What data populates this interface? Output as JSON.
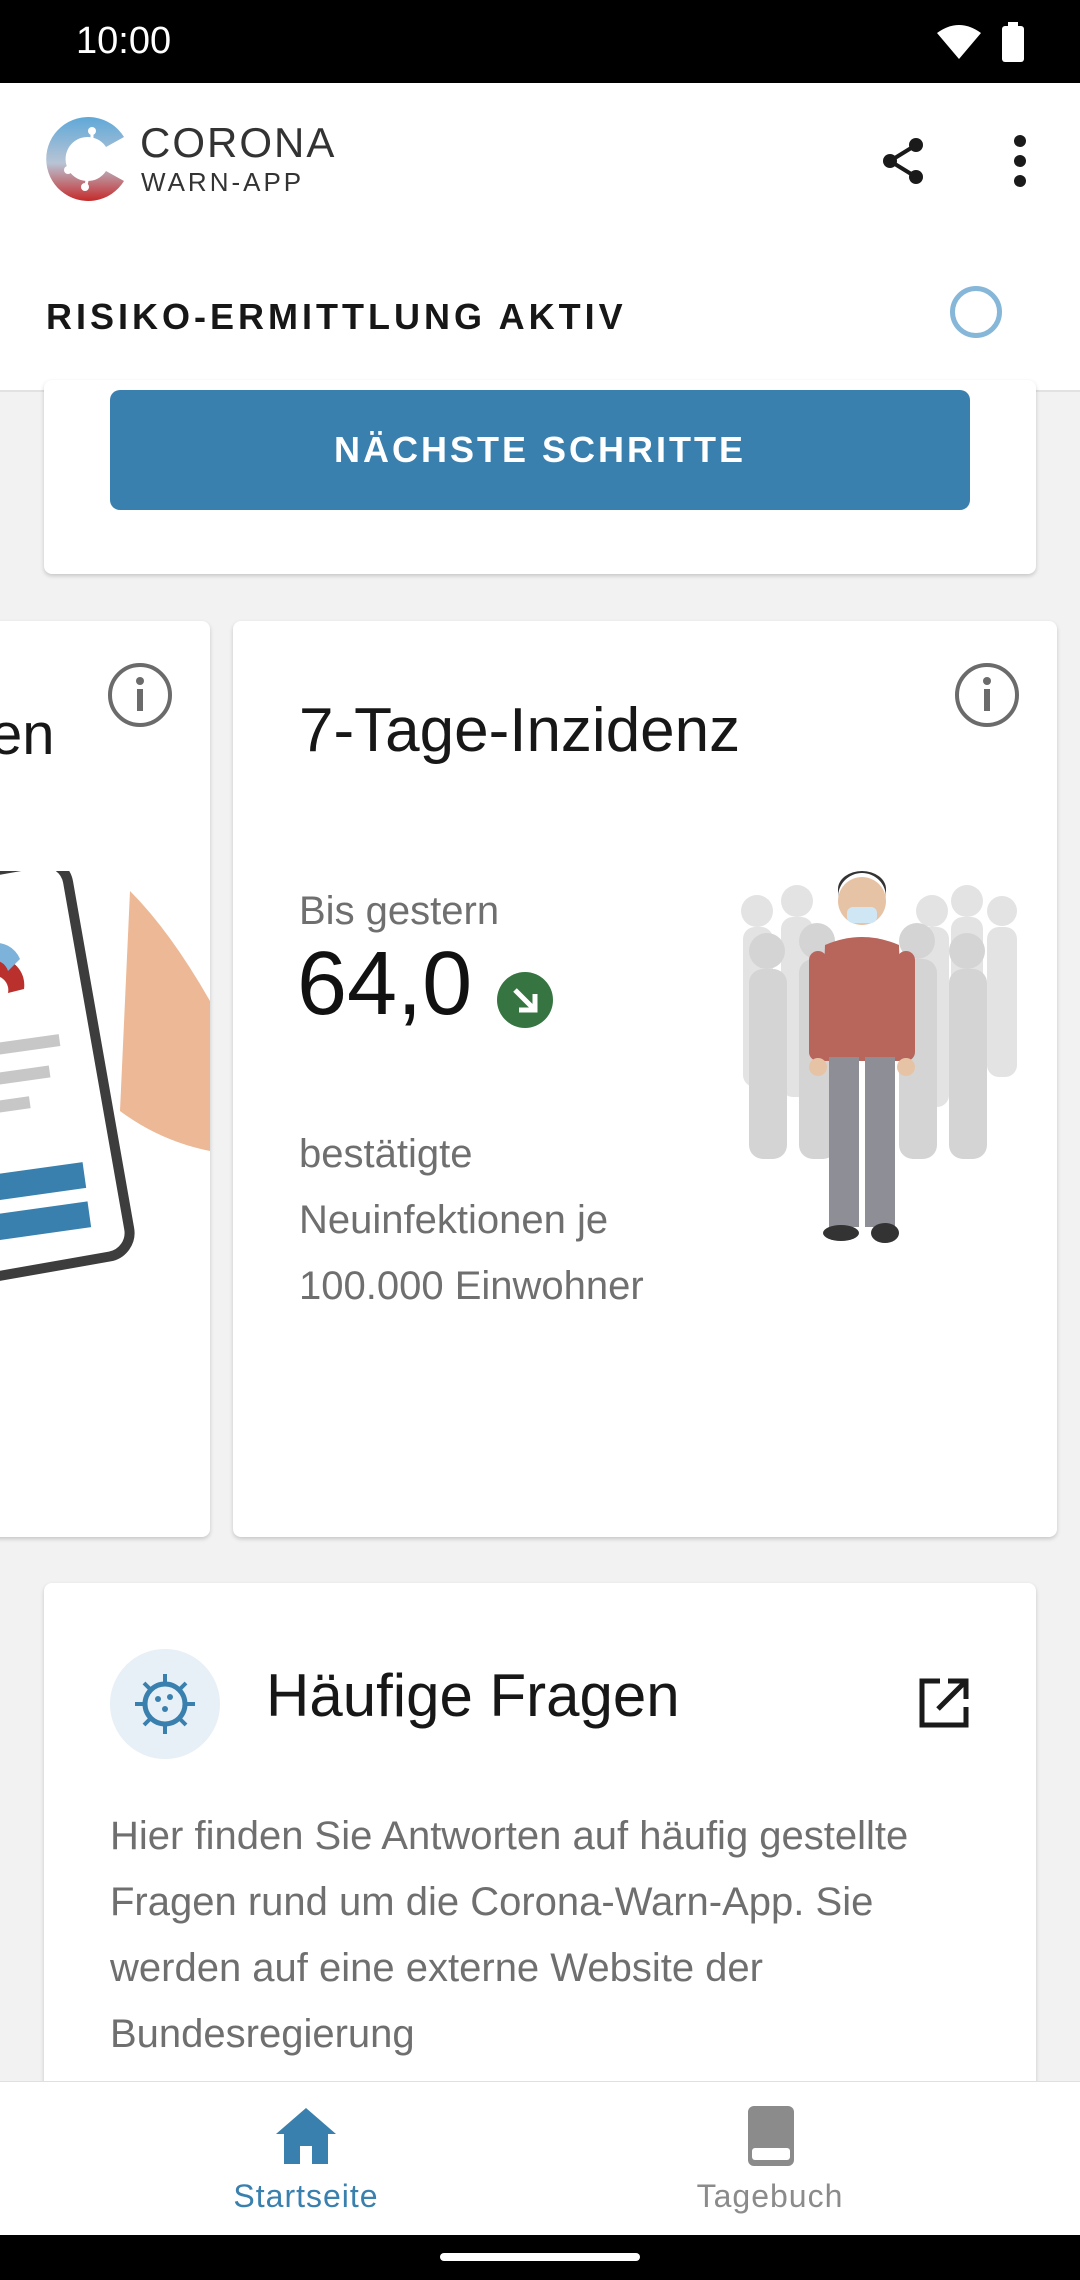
{
  "status_bar": {
    "time": "10:00"
  },
  "app": {
    "name_line1": "CORONA",
    "name_line2": "WARN-APP"
  },
  "risk_bar": {
    "label": "RISIKO-ERMITTLUNG AKTIV"
  },
  "next_steps": {
    "button_label": "NÄCHSTE SCHRITTE"
  },
  "left_card": {
    "title_fragment": "en"
  },
  "incidence": {
    "title": "7-Tage-Inzidenz",
    "subtitle": "Bis gestern",
    "value": "64,0",
    "description": "bestätigte Neuinfektionen je 100.000 Einwohner",
    "trend_color": "#367541"
  },
  "faq": {
    "title": "Häufige Fragen",
    "body": "Hier finden Sie Antworten auf häufig gestellte Fragen rund um die Corona-Warn-App. Sie werden auf eine externe Website der Bundesregierung"
  },
  "bottom_nav": {
    "items": [
      {
        "label": "Startseite",
        "active": true
      },
      {
        "label": "Tagebuch",
        "active": false
      }
    ]
  },
  "colors": {
    "accent": "#3a80ae",
    "muted": "#8b8b8b"
  }
}
